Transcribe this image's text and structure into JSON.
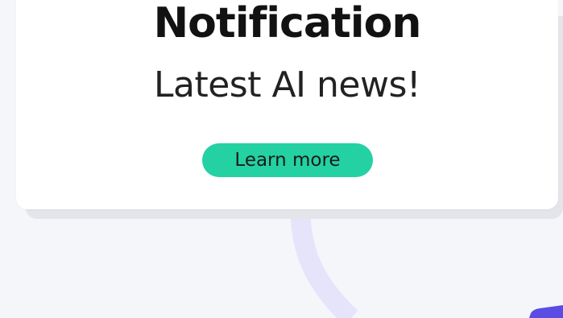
{
  "notification": {
    "title": "Notification",
    "message": "Latest AI news!",
    "cta_label": "Learn more"
  },
  "colors": {
    "background": "#f5f6fa",
    "card": "#ffffff",
    "card_shadow": "#e4e5ea",
    "accent": "#24d1a2",
    "curve": "#e6e4fb",
    "corner_tab": "#5b4ce3"
  }
}
